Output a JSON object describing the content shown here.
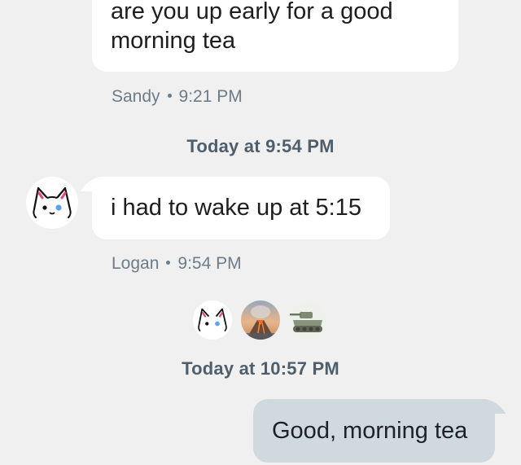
{
  "messages": [
    {
      "text": "are you up early for a good\nmorning tea",
      "sender": "Sandy",
      "time": "9:21 PM",
      "direction": "incoming"
    },
    {
      "text": "i had to wake up at 5:15",
      "sender": "Logan",
      "time": "9:54 PM",
      "direction": "incoming"
    },
    {
      "text": "Good, morning tea",
      "direction": "outgoing"
    }
  ],
  "separators": [
    {
      "label": "Today at 9:54 PM"
    },
    {
      "label": "Today at 10:57 PM"
    }
  ],
  "read_receipts": [
    {
      "icon": "cat-face-icon"
    },
    {
      "icon": "volcano-avatar-icon"
    },
    {
      "icon": "tank-avatar-icon"
    }
  ],
  "avatar_icon": "cat-face-icon",
  "colors": {
    "background": "#f0f0f0",
    "incoming_bubble": "#ffffff",
    "outgoing_bubble": "#d0d9de",
    "meta_text": "#6d7c89",
    "separator_text": "#4f5e6b"
  }
}
